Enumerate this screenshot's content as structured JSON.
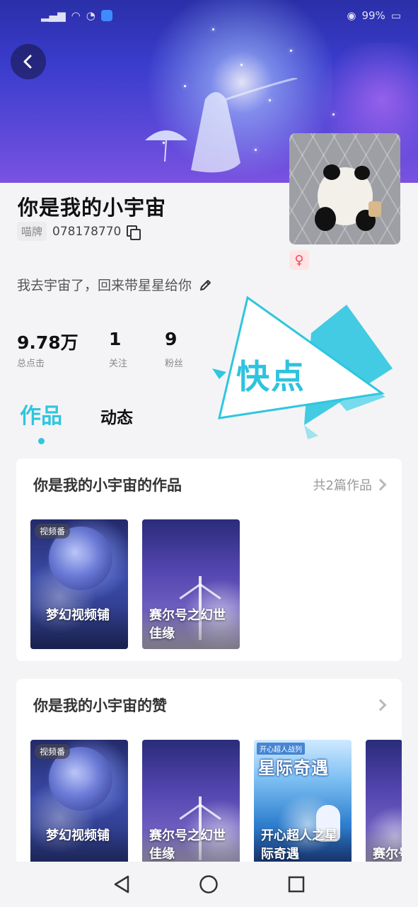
{
  "status_bar": {
    "battery": "99%"
  },
  "profile": {
    "nickname": "你是我的小宇宙",
    "id_tag": "喵牌",
    "id_value": "078178770",
    "bio": "我去宇宙了，回来带星星给你",
    "gender_symbol": "♀",
    "stats": [
      {
        "value": "9.78万",
        "label": "总点击"
      },
      {
        "value": "1",
        "label": "关注"
      },
      {
        "value": "9",
        "label": "粉丝"
      }
    ]
  },
  "tabs": [
    {
      "label": "作品",
      "active": true
    },
    {
      "label": "动态",
      "active": false
    }
  ],
  "watermark": {
    "text": "快点"
  },
  "works_card": {
    "title": "你是我的小宇宙的作品",
    "more": "共2篇作品",
    "items": [
      {
        "tag": "视频番",
        "label": "梦幻视频铺"
      },
      {
        "label": "赛尔号之幻世佳缘"
      }
    ]
  },
  "likes_card": {
    "title": "你是我的小宇宙的赞",
    "items": [
      {
        "tag": "视频番",
        "label": "梦幻视频铺"
      },
      {
        "label": "赛尔号之幻世佳缘"
      },
      {
        "cover_banner": "开心超人战列",
        "cover_title": "星际奇遇",
        "label": "开心超人之星际奇遇"
      },
      {
        "label": "赛尔号之幻世佳缘"
      }
    ]
  },
  "colors": {
    "accent": "#2fc6e0",
    "banner": "#3a3ccc",
    "gender_bg": "#ffe4e6",
    "gender_fg": "#ef4a5c"
  },
  "icons": {
    "back": "back-arrow-icon",
    "copy": "copy-icon",
    "edit": "pencil-edit-icon",
    "more": "chevron-right-icon",
    "nav_back": "triangle-back-icon",
    "nav_home": "circle-home-icon",
    "nav_recent": "square-recent-icon"
  }
}
